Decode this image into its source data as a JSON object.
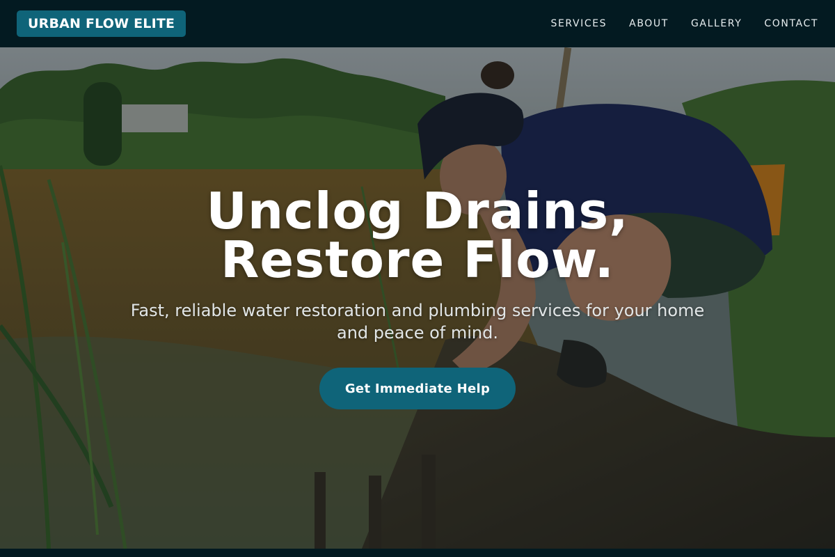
{
  "brand": {
    "name": "URBAN FLOW ELITE"
  },
  "nav": {
    "links": [
      "SERVICES",
      "ABOUT",
      "GALLERY",
      "CONTACT"
    ]
  },
  "hero": {
    "headline_line1": "Unclog Drains,",
    "headline_line2": "Restore Flow.",
    "subtext": "Fast, reliable water restoration and plumbing services for your home and peace of mind.",
    "cta_label": "Get Immediate Help"
  },
  "colors": {
    "nav_bg": "#031a21",
    "accent": "#0f6479",
    "text_light": "#ffffff"
  }
}
